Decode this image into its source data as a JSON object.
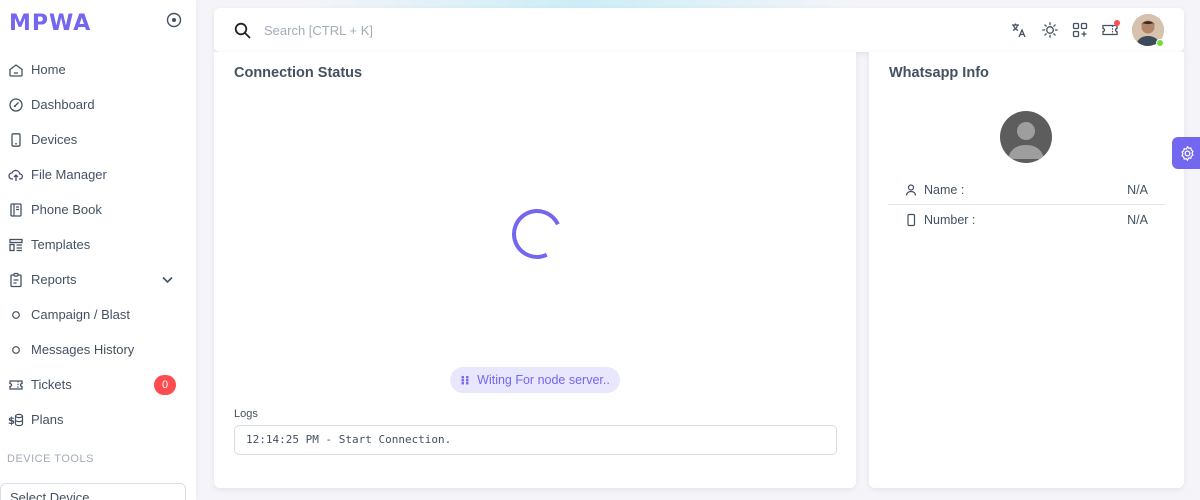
{
  "brand": {
    "name": "MPWA",
    "color": "#7367f0"
  },
  "sidebar": {
    "items": [
      {
        "label": "Home",
        "icon": "home-icon"
      },
      {
        "label": "Dashboard",
        "icon": "gauge-icon"
      },
      {
        "label": "Devices",
        "icon": "phone-icon"
      },
      {
        "label": "File Manager",
        "icon": "cloud-upload-icon"
      },
      {
        "label": "Phone Book",
        "icon": "book-icon"
      },
      {
        "label": "Templates",
        "icon": "template-icon"
      },
      {
        "label": "Reports",
        "icon": "clipboard-icon"
      },
      {
        "label": "Campaign / Blast",
        "icon": "circle-icon"
      },
      {
        "label": "Messages History",
        "icon": "circle-icon"
      },
      {
        "label": "Tickets",
        "icon": "ticket-icon",
        "badge": "0"
      },
      {
        "label": "Plans",
        "icon": "coins-icon"
      }
    ],
    "section_device_tools": "DEVICE TOOLS",
    "select_device": "Select Device"
  },
  "navbar": {
    "search_placeholder": "Search [CTRL + K]"
  },
  "connection": {
    "title": "Connection Status",
    "status": "Witing For node server..",
    "logs_label": "Logs",
    "log_line": "12:14:25 PM - Start Connection."
  },
  "whatsapp": {
    "title": "Whatsapp Info",
    "name_label": "Name :",
    "name_value": "N/A",
    "number_label": "Number :",
    "number_value": "N/A"
  },
  "colors": {
    "accent": "#7367f0",
    "danger": "#ff4c51",
    "online": "#71dd37"
  }
}
